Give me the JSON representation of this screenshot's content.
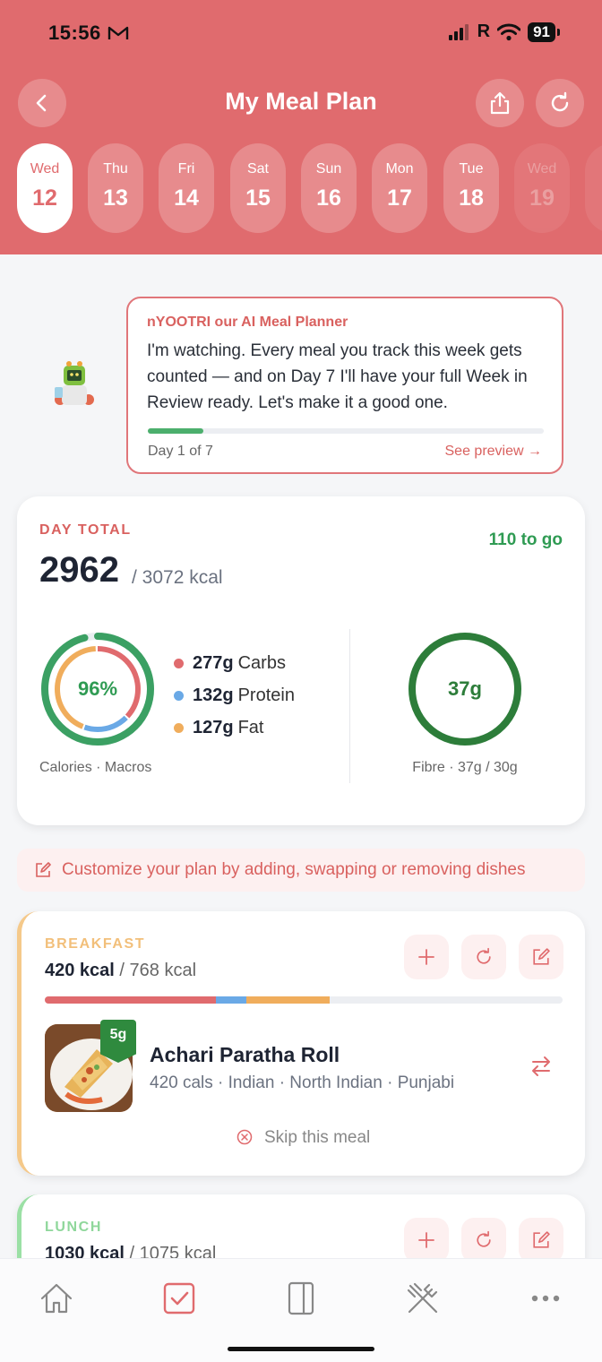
{
  "status_bar": {
    "time": "15:56",
    "carrier": "R",
    "battery": "91"
  },
  "header": {
    "title": "My Meal Plan",
    "background": "#e06b6e"
  },
  "days": [
    {
      "name": "Wed",
      "num": "12",
      "selected": true
    },
    {
      "name": "Thu",
      "num": "13"
    },
    {
      "name": "Fri",
      "num": "14"
    },
    {
      "name": "Sat",
      "num": "15"
    },
    {
      "name": "Sun",
      "num": "16"
    },
    {
      "name": "Mon",
      "num": "17"
    },
    {
      "name": "Tue",
      "num": "18"
    },
    {
      "name": "Wed",
      "num": "19"
    }
  ],
  "ai_card": {
    "title": "nYOOTRI our AI Meal Planner",
    "message": "I'm watching. Every meal you track this week gets counted — and on Day 7 I'll have your full Week in Review ready. Let's make it a good one.",
    "progress": 0.14,
    "day_label": "Day 1 of 7",
    "preview_link": "See preview →"
  },
  "day_total": {
    "label": "DAY TOTAL",
    "to_go": "110 to go",
    "kcal": "2962",
    "target": "/ 3072 kcal",
    "calories_pct": "96%",
    "caption": "Calories · Macros",
    "macros": [
      {
        "amount": "277g",
        "name": "Carbs",
        "color": "#e06b6e"
      },
      {
        "amount": "132g",
        "name": "Protein",
        "color": "#6aa9e6"
      },
      {
        "amount": "127g",
        "name": "Fat",
        "color": "#f0ad5c"
      }
    ],
    "fibre_value": "37g",
    "fibre_caption": "Fibre · 37g / 30g"
  },
  "customize_text": "Customize your plan by adding, swapping or removing dishes",
  "breakfast": {
    "label": "BREAKFAST",
    "kcal": "420 kcal",
    "target": "/ 768 kcal",
    "dish": {
      "badge": "5g",
      "name": "Achari Paratha Roll",
      "meta": "420 cals · Indian · North Indian · Punjabi"
    },
    "skip": "Skip this meal"
  },
  "lunch": {
    "label": "LUNCH",
    "kcal": "1030 kcal",
    "target": "/ 1075 kcal"
  },
  "nav": [
    "home-icon",
    "plan-icon",
    "journal-icon",
    "dishes-icon",
    "more-icon"
  ]
}
